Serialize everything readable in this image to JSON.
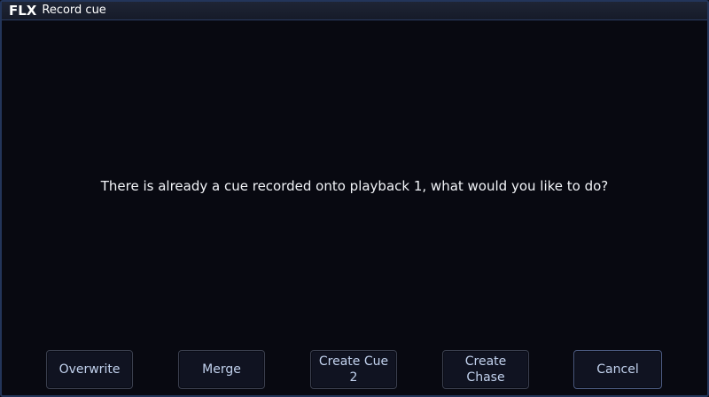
{
  "titlebar": {
    "logo": "FLX",
    "title": "Record cue"
  },
  "dialog": {
    "message": "There is already a cue recorded onto playback 1, what would you like to do?"
  },
  "buttons": {
    "overwrite": "Overwrite",
    "merge": "Merge",
    "create_cue": "Create Cue\n2",
    "create_chase": "Create\nChase",
    "cancel": "Cancel"
  }
}
